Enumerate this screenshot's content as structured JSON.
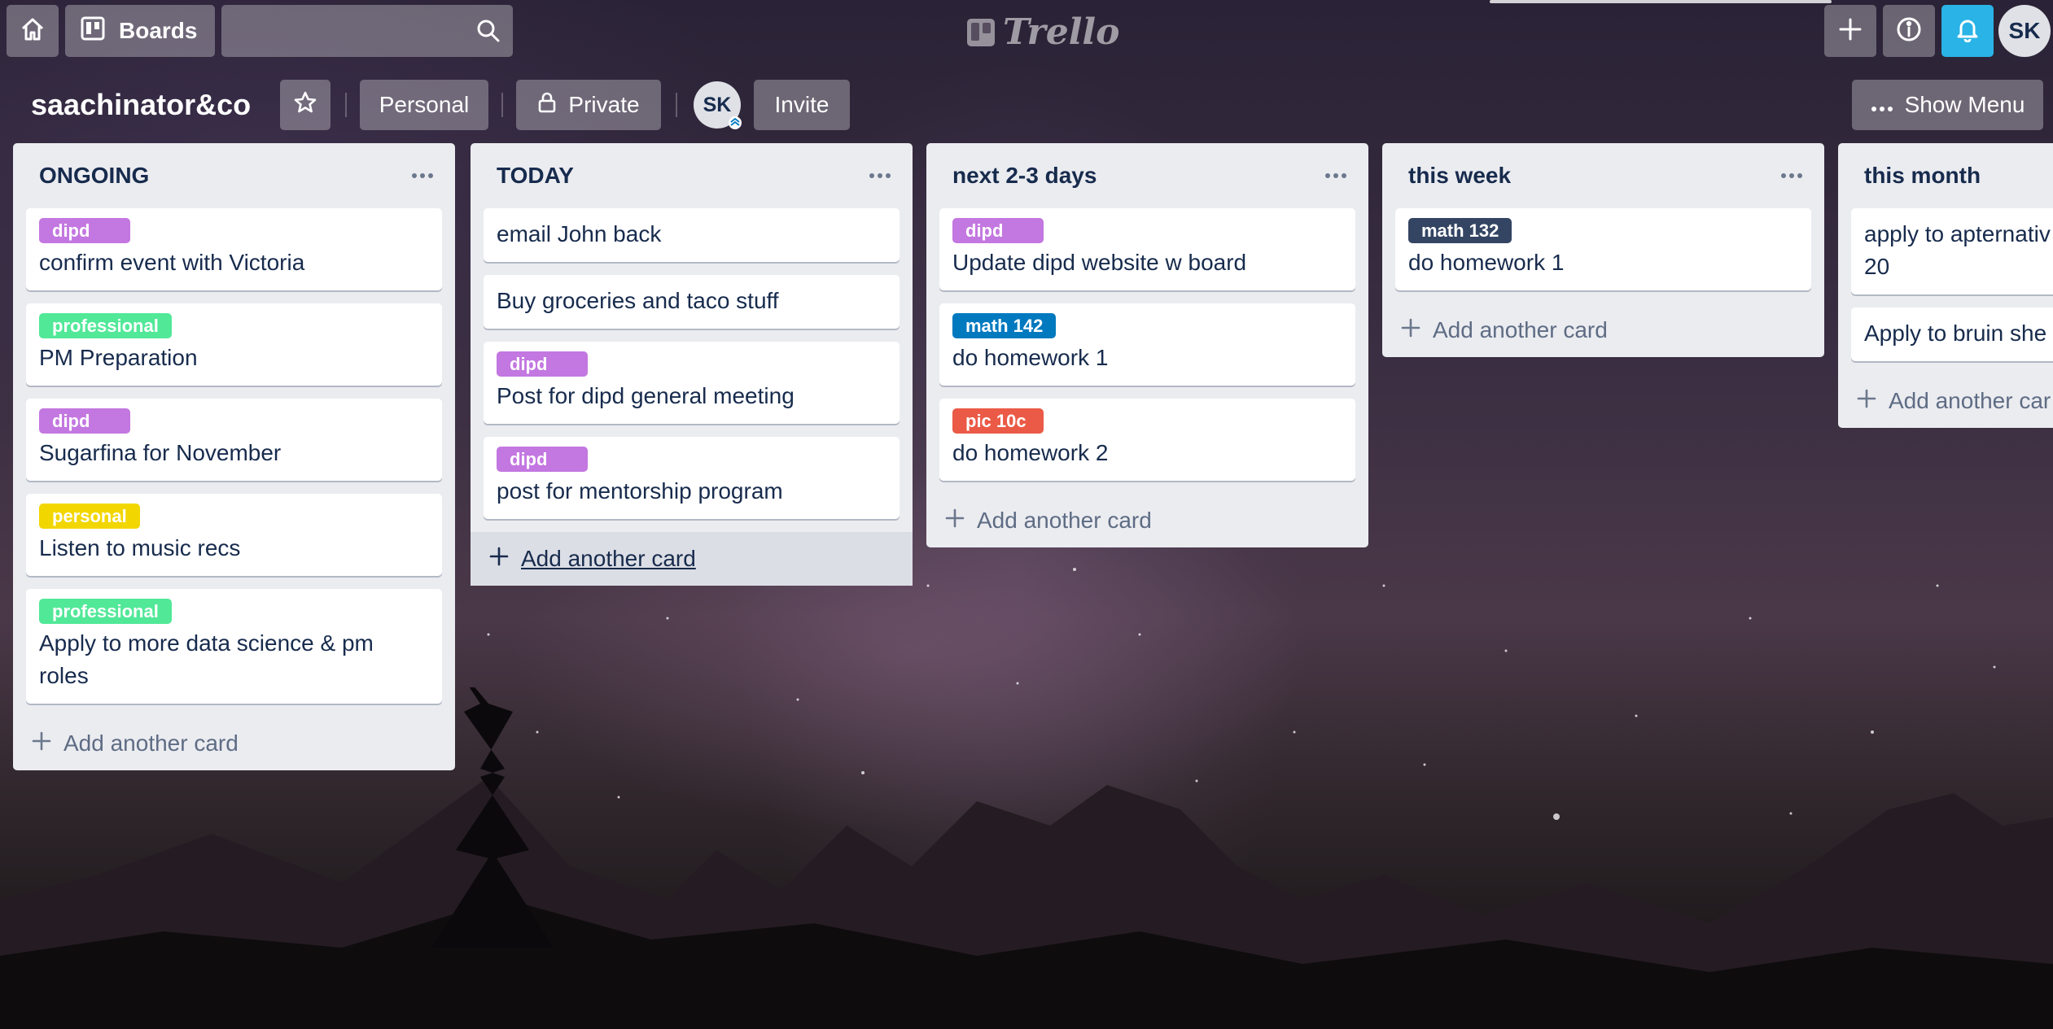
{
  "header": {
    "home_icon": "home-icon",
    "boards_label": "Boards",
    "search_value": "",
    "search_placeholder": "",
    "logo_text": "Trello",
    "user_initials": "SK",
    "notification_color": "#29b3e6"
  },
  "board": {
    "title": "saachinator&co",
    "visibility_team": "Personal",
    "visibility": "Private",
    "member_initials": "SK",
    "invite_label": "Invite",
    "show_menu_label": "Show Menu"
  },
  "lists": [
    {
      "title": "ONGOING",
      "add_label": "Add another card",
      "cards": [
        {
          "label": "dipd",
          "label_color": "#c377e0",
          "title": "confirm event with Victoria"
        },
        {
          "label": "professional",
          "label_color": "#51e898",
          "title": "PM Preparation"
        },
        {
          "label": "dipd",
          "label_color": "#c377e0",
          "title": "Sugarfina for November"
        },
        {
          "label": "personal",
          "label_color": "#f2d600",
          "title": "Listen to music recs"
        },
        {
          "label": "professional",
          "label_color": "#51e898",
          "title": "Apply to more data science & pm roles"
        }
      ]
    },
    {
      "title": "TODAY",
      "add_label": "Add another card",
      "cards": [
        {
          "label": "",
          "title": "email John back"
        },
        {
          "label": "",
          "title": "Buy groceries and taco stuff"
        },
        {
          "label": "dipd",
          "label_color": "#c377e0",
          "title": "Post for dipd general meeting"
        },
        {
          "label": "dipd",
          "label_color": "#c377e0",
          "title": "post for mentorship program"
        }
      ]
    },
    {
      "title": "next 2-3 days",
      "add_label": "Add another card",
      "cards": [
        {
          "label": "dipd",
          "label_color": "#c377e0",
          "title": "Update dipd website w board"
        },
        {
          "label": "math 142",
          "label_color": "#0079bf",
          "title": "do homework 1"
        },
        {
          "label": "pic 10c",
          "label_color": "#eb5a46",
          "title": "do homework 2"
        }
      ]
    },
    {
      "title": "this week",
      "add_label": "Add another card",
      "cards": [
        {
          "label": "math 132",
          "label_color": "#344563",
          "title": "do homework 1"
        }
      ]
    },
    {
      "title": "this month",
      "add_label": "Add another car",
      "cards": [
        {
          "label": "",
          "title": "apply to apternativ 20"
        },
        {
          "label": "",
          "title": "Apply to bruin she"
        }
      ]
    }
  ]
}
